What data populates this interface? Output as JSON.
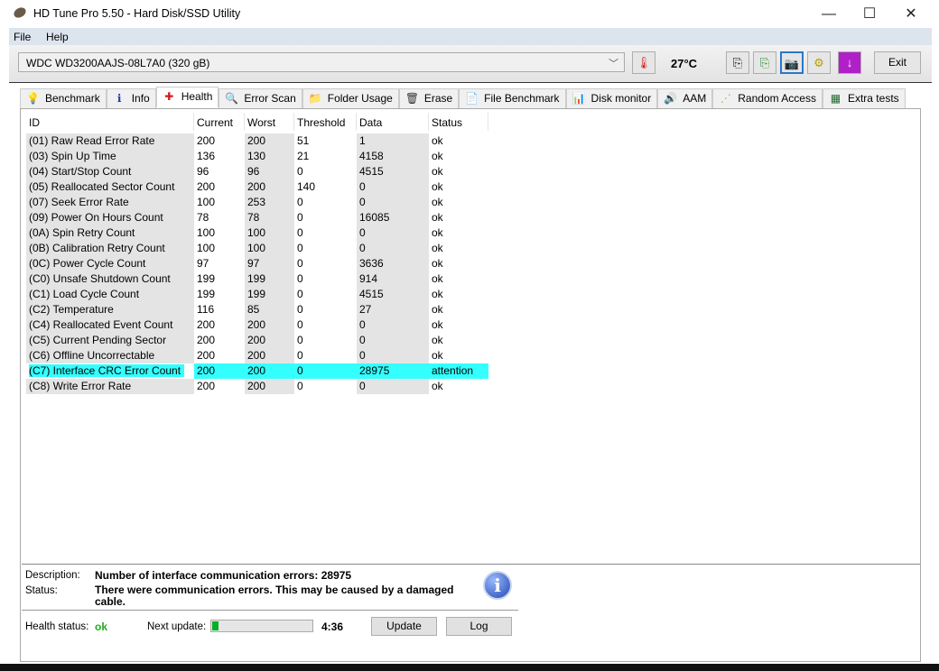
{
  "window": {
    "title": "HD Tune Pro 5.50 - Hard Disk/SSD Utility",
    "minimize": "—",
    "maximize": "☐",
    "close": "✕"
  },
  "menu": {
    "file": "File",
    "help": "Help"
  },
  "toolbar": {
    "drive": "WDC WD3200AAJS-08L7A0 (320 gB)",
    "temperature": "27°C",
    "exit": "Exit"
  },
  "tabs": [
    {
      "label": "Benchmark",
      "icon": "💡"
    },
    {
      "label": "Info",
      "icon": "ℹ"
    },
    {
      "label": "Health",
      "icon": "✚"
    },
    {
      "label": "Error Scan",
      "icon": "🔍"
    },
    {
      "label": "Folder Usage",
      "icon": "📁"
    },
    {
      "label": "Erase",
      "icon": "🗑"
    },
    {
      "label": "File Benchmark",
      "icon": "📄"
    },
    {
      "label": "Disk monitor",
      "icon": "📊"
    },
    {
      "label": "AAM",
      "icon": "🔊"
    },
    {
      "label": "Random Access",
      "icon": "⋰"
    },
    {
      "label": "Extra tests",
      "icon": "▦"
    }
  ],
  "table": {
    "headers": [
      "ID",
      "Current",
      "Worst",
      "Threshold",
      "Data",
      "Status"
    ],
    "rows": [
      [
        "(01) Raw Read Error Rate",
        "200",
        "200",
        "51",
        "1",
        "ok"
      ],
      [
        "(03) Spin Up Time",
        "136",
        "130",
        "21",
        "4158",
        "ok"
      ],
      [
        "(04) Start/Stop Count",
        "96",
        "96",
        "0",
        "4515",
        "ok"
      ],
      [
        "(05) Reallocated Sector Count",
        "200",
        "200",
        "140",
        "0",
        "ok"
      ],
      [
        "(07) Seek Error Rate",
        "100",
        "253",
        "0",
        "0",
        "ok"
      ],
      [
        "(09) Power On Hours Count",
        "78",
        "78",
        "0",
        "16085",
        "ok"
      ],
      [
        "(0A) Spin Retry Count",
        "100",
        "100",
        "0",
        "0",
        "ok"
      ],
      [
        "(0B) Calibration Retry Count",
        "100",
        "100",
        "0",
        "0",
        "ok"
      ],
      [
        "(0C) Power Cycle Count",
        "97",
        "97",
        "0",
        "3636",
        "ok"
      ],
      [
        "(C0) Unsafe Shutdown Count",
        "199",
        "199",
        "0",
        "914",
        "ok"
      ],
      [
        "(C1) Load Cycle Count",
        "199",
        "199",
        "0",
        "4515",
        "ok"
      ],
      [
        "(C2) Temperature",
        "116",
        "85",
        "0",
        "27",
        "ok"
      ],
      [
        "(C4) Reallocated Event Count",
        "200",
        "200",
        "0",
        "0",
        "ok"
      ],
      [
        "(C5) Current Pending Sector",
        "200",
        "200",
        "0",
        "0",
        "ok"
      ],
      [
        "(C6) Offline Uncorrectable",
        "200",
        "200",
        "0",
        "0",
        "ok"
      ],
      [
        "(C7) Interface CRC Error Count",
        "200",
        "200",
        "0",
        "28975",
        "attention"
      ],
      [
        "(C8) Write Error Rate",
        "200",
        "200",
        "0",
        "0",
        "ok"
      ]
    ],
    "selected_row": 15
  },
  "details": {
    "description_label": "Description:",
    "description": "Number of interface communication errors: 28975",
    "status_label": "Status:",
    "status": "There were communication errors. This may be caused by a damaged cable."
  },
  "footer": {
    "health_label": "Health status:",
    "health": "ok",
    "health_color": "#1fae1f",
    "next_update_label": "Next update:",
    "progress_percent": 6,
    "countdown": "4:36",
    "update": "Update",
    "log": "Log"
  }
}
